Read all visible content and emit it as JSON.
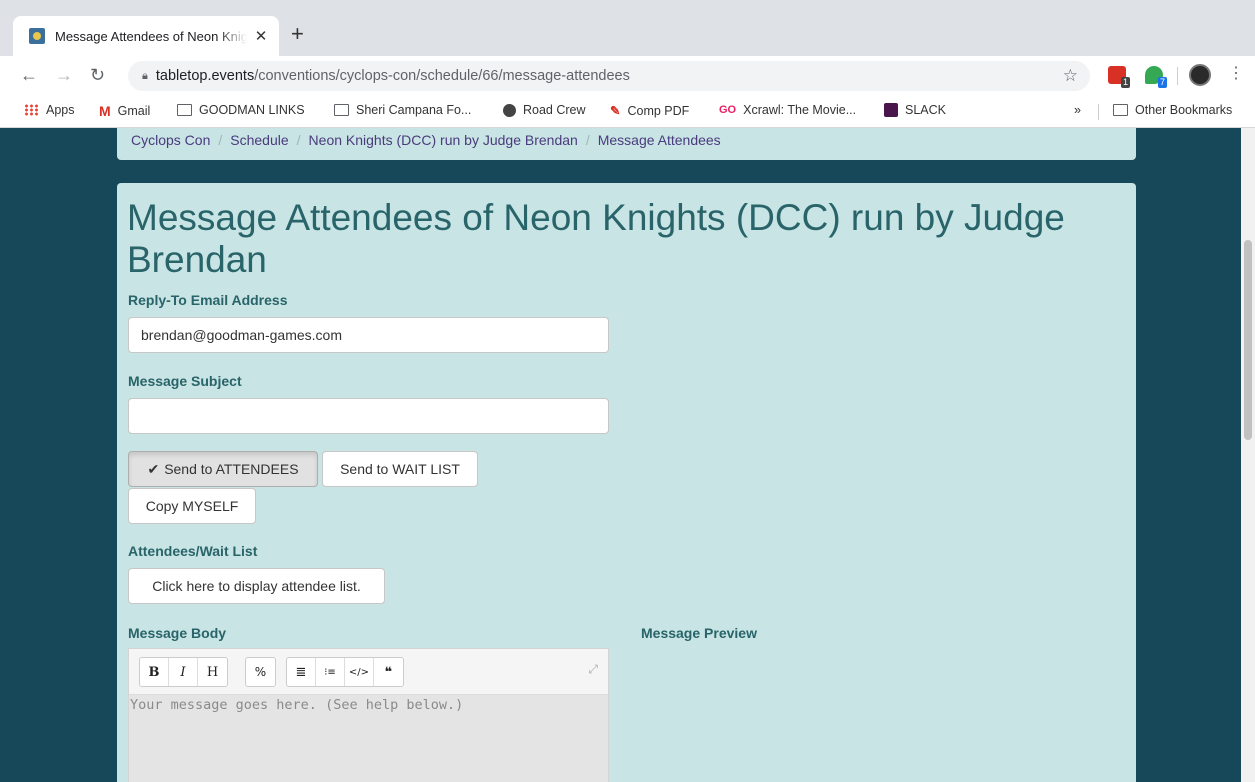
{
  "browser": {
    "tab_title": "Message Attendees of Neon Knights (DCC) run by Judge Brendan",
    "new_tab": "+",
    "tab_close": "✕",
    "url_host": "tabletop.events",
    "url_path": "/conventions/cyclops-con/schedule/66/message-attendees",
    "extensions": [
      {
        "name": "calendar-extension-icon",
        "badge": "1",
        "color": "#d93025",
        "badge_color": "#444"
      },
      {
        "name": "maps-extension-icon",
        "badge": "7",
        "color": "#34a853",
        "badge_color": "#1a73e8"
      }
    ],
    "bookmarks": [
      {
        "label": "Apps",
        "icon": "apps-icon"
      },
      {
        "label": "Gmail",
        "icon": "gmail-icon"
      },
      {
        "label": "GOODMAN LINKS",
        "icon": "folder-icon"
      },
      {
        "label": "Sheri Campana Fo...",
        "icon": "folder-icon"
      },
      {
        "label": "Road Crew",
        "icon": "globe-icon"
      },
      {
        "label": "Comp PDF",
        "icon": "pdf-icon"
      },
      {
        "label": "Xcrawl: The Movie...",
        "icon": "go-icon"
      },
      {
        "label": "SLACK",
        "icon": "slack-icon"
      }
    ],
    "overflow": "»",
    "other_bookmarks": "Other Bookmarks"
  },
  "breadcrumb": [
    "Cyclops Con",
    "Schedule",
    "Neon Knights (DCC) run by Judge Brendan",
    "Message Attendees"
  ],
  "breadcrumb_sep": "/",
  "page_title": "Message Attendees of Neon Knights (DCC) run by Judge Brendan",
  "form": {
    "reply_to_label": "Reply-To Email Address",
    "reply_to_value": "brendan@goodman-games.com",
    "subject_label": "Message Subject",
    "subject_value": "",
    "send_attendees": "Send to ATTENDEES",
    "send_attendees_active": true,
    "send_waitlist": "Send to WAIT LIST",
    "copy_myself": "Copy MYSELF",
    "attendees_label": "Attendees/Wait List",
    "display_list_button": "Click here to display attendee list.",
    "body_label": "Message Body",
    "preview_label": "Message Preview",
    "body_placeholder": "Your message goes here.  (See help below.)"
  },
  "editor_toolbar": [
    [
      "B",
      "I",
      "H"
    ],
    [
      "%"
    ],
    [
      "≣",
      "⁝≡",
      "</>",
      "❝"
    ]
  ],
  "colors": {
    "page_bg": "#17485a",
    "panel_bg": "#c8e4e4",
    "heading": "#286469",
    "crumb_link": "#4a3b7d"
  }
}
